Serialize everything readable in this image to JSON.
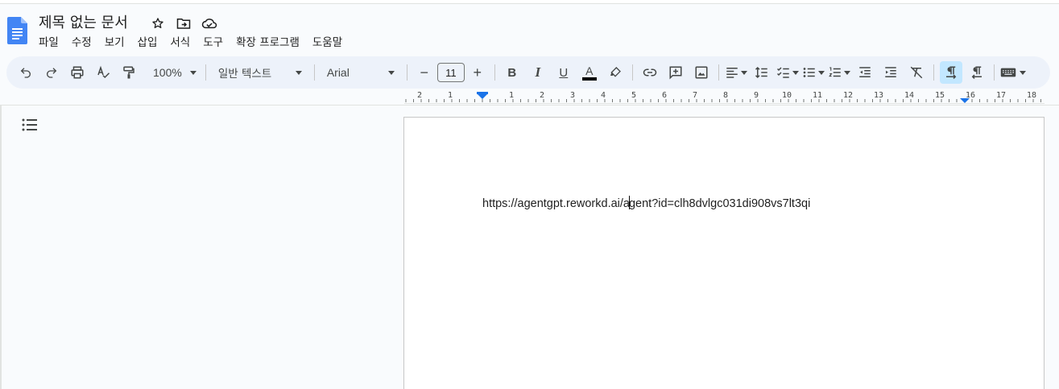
{
  "doc": {
    "title": "제목 없는 문서",
    "body_text_before_cursor": "https://agentgpt.reworkd.ai/a",
    "body_text_after_cursor": "gent?id=clh8dvlgc031di908vs7lt3qi"
  },
  "menubar": {
    "items": [
      "파일",
      "수정",
      "보기",
      "삽입",
      "서식",
      "도구",
      "확장 프로그램",
      "도움말"
    ]
  },
  "toolbar": {
    "zoom": "100%",
    "paragraph_style": "일반 텍스트",
    "font": "Arial",
    "font_size": "11",
    "minus": "−",
    "plus": "+",
    "bold": "B",
    "italic": "I",
    "underline": "U",
    "text_color": "A"
  },
  "ruler": {
    "labels": [
      "2",
      "1",
      "1",
      "2",
      "3",
      "4",
      "5",
      "6",
      "7",
      "8",
      "9",
      "10",
      "11",
      "12",
      "13",
      "14",
      "15",
      "16",
      "17",
      "18"
    ]
  },
  "colors": {
    "brand": "#4285f4",
    "toolbar_bg": "#edf2fa",
    "active": "#c2e7ff"
  },
  "icons": {
    "logo": "google-docs-icon",
    "star": "star-icon",
    "move": "folder-move-icon",
    "cloud": "cloud-status-icon",
    "outline": "document-outline-icon"
  }
}
